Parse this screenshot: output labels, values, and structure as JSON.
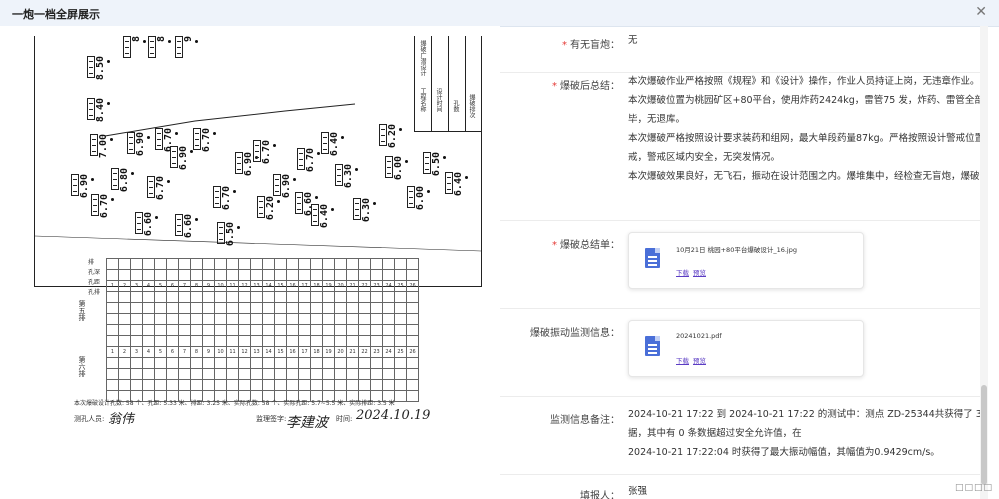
{
  "window": {
    "title": "一炮一档全屏展示",
    "close_icon": "✕"
  },
  "blast_photo": {
    "hole_values": [
      "8",
      "8",
      "9",
      "8.50",
      "8.40",
      "6.70",
      "7.00",
      "6.90",
      "6.90",
      "6.70",
      "6.80",
      "6.70",
      "6.90",
      "6.70",
      "6.60",
      "6.60",
      "6.70",
      "6.90",
      "6.50",
      "6.70",
      "6.90",
      "6.70",
      "6.60",
      "6.20",
      "6.40",
      "6.30",
      "6.30",
      "6.40",
      "6.20",
      "6.00",
      "6.00",
      "6.50",
      "6.40"
    ],
    "title_block_text": [
      "工程名称",
      "设计时间",
      "孔数",
      "爆破排次",
      "爆破方式",
      "爆破广潜设计",
      "炸药",
      "雷管"
    ],
    "table_headers": [
      "排",
      "孔深",
      "孔距",
      "孔排"
    ],
    "row_labels": [
      "第五排",
      "第六排"
    ],
    "column_numbers": [
      "1",
      "2",
      "3",
      "4",
      "5",
      "6",
      "7",
      "8",
      "9",
      "10",
      "11",
      "12",
      "13",
      "14",
      "15",
      "16",
      "17",
      "18",
      "19",
      "20",
      "21",
      "22",
      "23",
      "24",
      "25",
      "26"
    ],
    "footer_line": "本次爆破设计孔数:  58  个、孔距:  5.33  米、排距:  3.25  米、实际孔数:  58  个、实际孔距:  5.7~5.5  米、实际排距:  3.5  米",
    "signature_driller_label": "测孔人员:",
    "signature_driller": "翁伟",
    "signature_supervisor_label": "监理签字:",
    "signature_supervisor": "李建波",
    "time_label": "时间:",
    "time_value": "2024.10.19"
  },
  "fields": {
    "misfire": {
      "label": "有无盲炮：",
      "required": true,
      "value": "无"
    },
    "summary": {
      "label": "爆破后总结：",
      "required": true,
      "lines": [
        "本次爆破作业严格按照《规程》和《设计》操作，作业人员持证上岗，无违章作业。",
        "本次爆破位置为桃园矿区+80平台，使用炸药2424kg，雷管75 发，炸药、雷管全部使用完",
        "毕，无退库。",
        "本次爆破严格按照设计要求装药和组网，最大单段药量87kg。严格按照设计警戒位置进行警",
        "戒，警戒区域内安全，无突发情况。",
        "本次爆破效果良好，无飞石，振动在设计范围之内。爆堆集中，经检查无盲炮，爆破作业安全"
      ]
    },
    "summary_sheet": {
      "label": "爆破总结单：",
      "required": true,
      "file_name": "10月21日 桃园+80平台爆破设计_16.jpg",
      "download": "下载",
      "preview": "预览"
    },
    "vibration_monitor": {
      "label": "爆破振动监测信息：",
      "required": false,
      "file_name": "20241021.pdf",
      "download": "下载",
      "preview": "预览"
    },
    "monitor_note": {
      "label": "监测信息备注：",
      "required": false,
      "lines": [
        "2024-10-21 17:22 到 2024-10-21 17:22 的测试中：测点 ZD-25344共获得了 3 条有效数",
        "据，其中有 0 条数据超过安全允许值，在",
        "2024-10-21 17:22:04 时获得了最大振动幅值，其幅值为0.9429cm/s。"
      ]
    },
    "reporter": {
      "label": "填报人：",
      "required": false,
      "value": "张强"
    }
  },
  "corner_text": "□□□□",
  "colors": {
    "accent": "#4a6fd8",
    "link": "#5b3cc4",
    "required": "#e53935"
  }
}
